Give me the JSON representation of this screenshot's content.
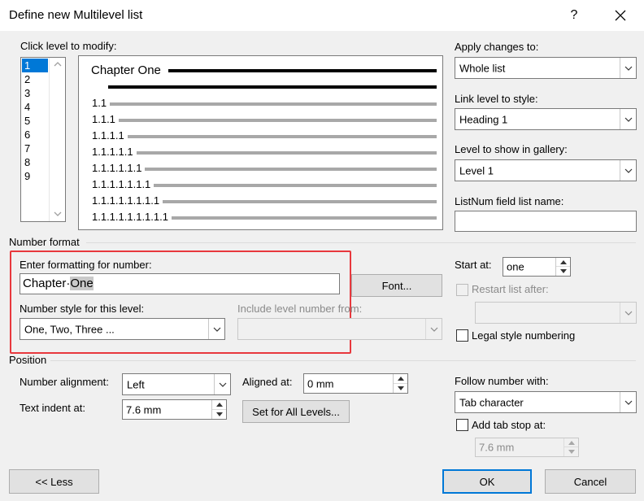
{
  "window": {
    "title": "Define new Multilevel list",
    "help": "?",
    "close": "✕"
  },
  "levels": {
    "label": "Click level to modify:",
    "items": [
      "1",
      "2",
      "3",
      "4",
      "5",
      "6",
      "7",
      "8",
      "9"
    ]
  },
  "preview": {
    "heading": "Chapter One",
    "rows": [
      "1.1",
      "1.1.1",
      "1.1.1.1",
      "1.1.1.1.1",
      "1.1.1.1.1.1",
      "1.1.1.1.1.1.1",
      "1.1.1.1.1.1.1.1",
      "1.1.1.1.1.1.1.1.1"
    ]
  },
  "right": {
    "apply_label": "Apply changes to:",
    "apply_value": "Whole list",
    "link_label": "Link level to style:",
    "link_value": "Heading 1",
    "gallery_label": "Level to show in gallery:",
    "gallery_value": "Level 1",
    "listnum_label": "ListNum field list name:",
    "listnum_value": ""
  },
  "number_format": {
    "section": "Number format",
    "enter_label": "Enter formatting for number:",
    "format_prefix": "Chapter·",
    "format_selected": "One",
    "font_button": "Font...",
    "style_label": "Number style for this level:",
    "style_value": "One, Two, Three ...",
    "include_label": "Include level number from:",
    "include_value": "",
    "start_label": "Start at:",
    "start_value": "one",
    "restart_label": "Restart list after:",
    "restart_value": "",
    "legal_label": "Legal style numbering"
  },
  "position": {
    "section": "Position",
    "align_label": "Number alignment:",
    "align_value": "Left",
    "aligned_at_label": "Aligned at:",
    "aligned_at_value": "0 mm",
    "indent_label": "Text indent at:",
    "indent_value": "7.6 mm",
    "set_all_button": "Set for All Levels...",
    "follow_label": "Follow number with:",
    "follow_value": "Tab character",
    "tabstop_label": "Add tab stop at:",
    "tabstop_value": "7.6 mm"
  },
  "buttons": {
    "less": "<< Less",
    "ok": "OK",
    "cancel": "Cancel"
  },
  "colors": {
    "accent": "#0078d7",
    "highlight_box": "#e8383d"
  }
}
